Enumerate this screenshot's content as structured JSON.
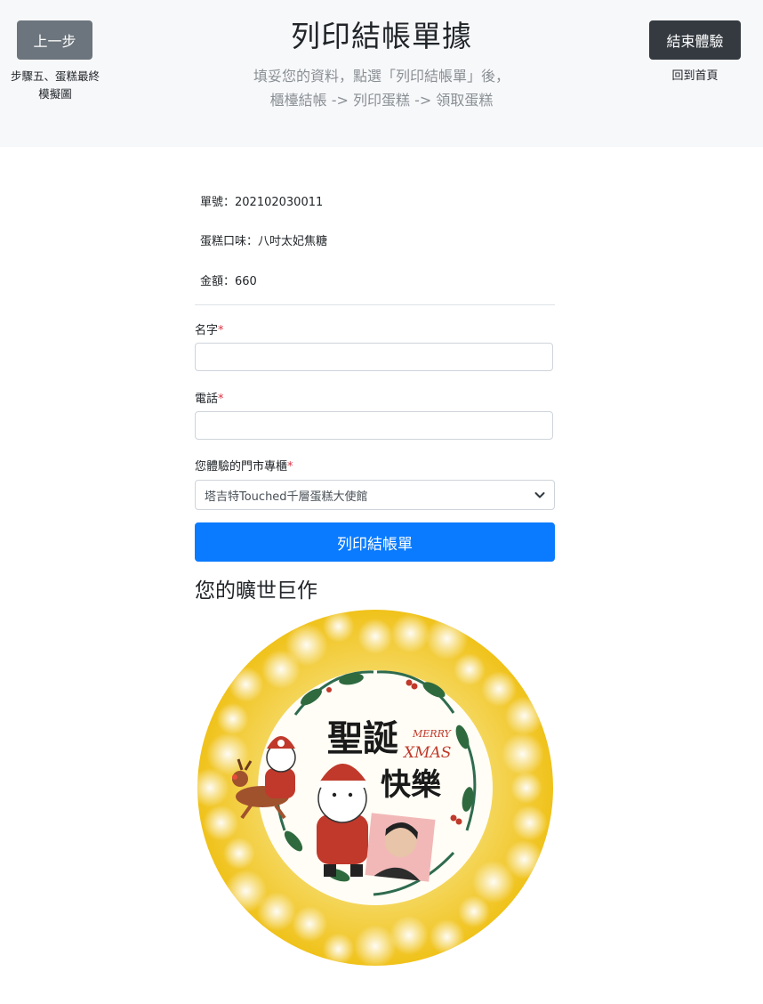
{
  "header": {
    "prev_label": "上一步",
    "step_line1": "步驟五、蛋糕最終",
    "step_line2": "模擬圖",
    "title": "列印結帳單據",
    "subtitle_line1": "填妥您的資料，點選「列印結帳單」後，",
    "subtitle_line2": "櫃檯結帳 -> 列印蛋糕 -> 領取蛋糕",
    "end_label": "結束體驗",
    "home_label": "回到首頁"
  },
  "order": {
    "number": "單號：202102030011",
    "flavor": "蛋糕口味：八吋太妃焦糖",
    "amount": "金額：660"
  },
  "form": {
    "name_label": "名字",
    "phone_label": "電話",
    "store_label": "您體驗的門市專櫃",
    "required_mark": "*",
    "name_value": "",
    "phone_value": "",
    "store_selected": "塔吉特Touched千層蛋糕大使館",
    "print_button": "列印結帳單"
  },
  "preview": {
    "heading": "您的曠世巨作",
    "cake_text_1": "聖誕",
    "cake_text_2": "快樂",
    "cake_merry": "MERRY",
    "cake_xmas": "XMAS"
  },
  "colors": {
    "primary": "#0a7bff",
    "secondary": "#6c757d",
    "dark": "#343a40",
    "required": "#dc3545",
    "cake_yellow": "#f2c414"
  }
}
